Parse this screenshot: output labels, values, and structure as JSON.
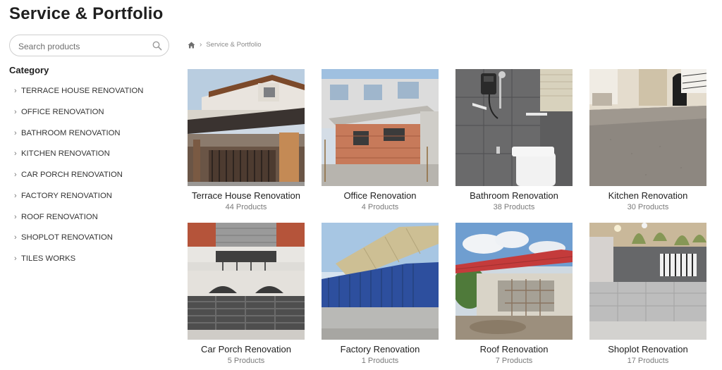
{
  "page": {
    "title": "Service & Portfolio"
  },
  "search": {
    "placeholder": "Search products"
  },
  "sidebar": {
    "heading": "Category",
    "items": [
      {
        "label": "TERRACE HOUSE RENOVATION"
      },
      {
        "label": "OFFICE RENOVATION"
      },
      {
        "label": "BATHROOM RENOVATION"
      },
      {
        "label": "KITCHEN RENOVATION"
      },
      {
        "label": "CAR PORCH RENOVATION"
      },
      {
        "label": "FACTORY RENOVATION"
      },
      {
        "label": "ROOF RENOVATION"
      },
      {
        "label": "SHOPLOT RENOVATION"
      },
      {
        "label": "TILES WORKS"
      }
    ]
  },
  "breadcrumb": {
    "home_icon": "home-icon",
    "current": "Service & Portfolio"
  },
  "products": [
    {
      "name": "Terrace House Renovation",
      "count": "44 Products"
    },
    {
      "name": "Office Renovation",
      "count": "4 Products"
    },
    {
      "name": "Bathroom Renovation",
      "count": "38 Products"
    },
    {
      "name": "Kitchen Renovation",
      "count": "30 Products"
    },
    {
      "name": "Car Porch Renovation",
      "count": "5 Products"
    },
    {
      "name": "Factory Renovation",
      "count": "1 Products"
    },
    {
      "name": "Roof Renovation",
      "count": "7 Products"
    },
    {
      "name": "Shoplot Renovation",
      "count": "17 Products"
    }
  ]
}
